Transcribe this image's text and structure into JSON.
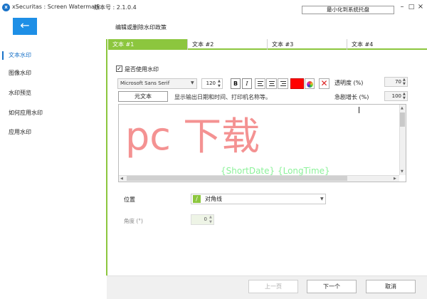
{
  "app": {
    "logo_letter": "x",
    "title": "xSecuritas : Screen Watermark",
    "version": "版本号 : 2.1.0.4",
    "minimize_to_tray": "最小化到系统托盘"
  },
  "window_controls": {
    "minimize": "–",
    "maximize": "□",
    "close": "×"
  },
  "header": {
    "back_glyph": "←",
    "heading": "编辑或删除水印政策"
  },
  "sidebar": {
    "items": [
      {
        "label": "文本水印",
        "active": true
      },
      {
        "label": "图像水印",
        "active": false
      },
      {
        "label": "水印预览",
        "active": false
      },
      {
        "label": "如何应用水印",
        "active": false
      },
      {
        "label": "应用水印",
        "active": false
      }
    ]
  },
  "tabs": [
    "文本 #1",
    "文本 #2",
    "文本 #3",
    "文本 #4"
  ],
  "form": {
    "use_watermark_checked": true,
    "check_glyph": "✓",
    "use_watermark_label": "是否使用水印",
    "font_family": "Microsoft Sans Serif",
    "font_size": "120",
    "bold": "B",
    "italic": "I",
    "text_color": "#ff0000",
    "clear_glyph": "✕",
    "transparency_label": "透明度 (%)",
    "transparency_value": "70",
    "sharp_increase_label": "急剧增长 (%)",
    "sharp_increase_value": "100",
    "meta_text_button": "元文本",
    "meta_hint": "显示输出日期和时间、打印机名称等。",
    "watermark_text": "{ShortDate}  {LongTime}",
    "position_label": "位置",
    "position_value": "对角线",
    "position_icon": "/",
    "angle_label": "角度 (°)",
    "angle_value": "0"
  },
  "overlay_logo": "pc  下载",
  "footer": {
    "prev": "上一页",
    "next": "下一个",
    "cancel": "取消"
  },
  "colors": {
    "accent_green": "#8cc63e",
    "primary_blue": "#1e8fe6"
  }
}
